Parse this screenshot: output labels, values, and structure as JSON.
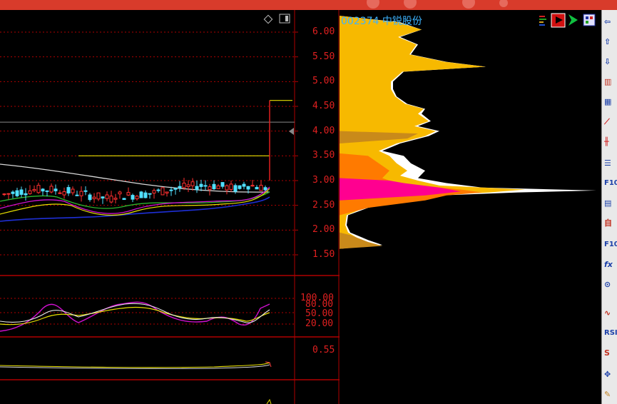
{
  "window": {
    "accent": "#d83b2b"
  },
  "stock": {
    "code": "002374",
    "name": "中锐股份",
    "label": "002374 中锐股份"
  },
  "price_axis": {
    "labels": [
      "6.00",
      "5.50",
      "5.00",
      "4.50",
      "4.00",
      "3.50",
      "3.00",
      "2.50",
      "2.00",
      "1.50"
    ]
  },
  "kdj_axis": {
    "labels": [
      "100.00",
      "80.00",
      "50.00",
      "20.00"
    ]
  },
  "sub_axis": {
    "labels": [
      "0.55"
    ]
  },
  "toolbar": {
    "items": [
      "back-arrow",
      "up-arrow",
      "down-arrow",
      "kline",
      "grid",
      "line",
      "candles",
      "list",
      "F10",
      "chip",
      "自",
      "F10",
      "fx",
      "search",
      "wave",
      "RS",
      "S",
      "move",
      "pen"
    ]
  },
  "tool_text": {
    "f10": "F10",
    "zi": "自",
    "f10b": "F10",
    "fx": "fx",
    "rsi": "RSI",
    "s": "S"
  },
  "chart_data": {
    "type": "candlestick",
    "ylim": [
      1.5,
      6.2
    ],
    "reference_lines": {
      "high_marker": 4.62,
      "white_line": 4.18,
      "yellow_line": 3.5
    },
    "volume_profile": {
      "price_levels": [
        1.65,
        1.8,
        1.95,
        2.1,
        2.25,
        2.4,
        2.55,
        2.7,
        2.8,
        2.9,
        3.0,
        3.1,
        3.2,
        3.3,
        3.45,
        3.6,
        3.8,
        4.0,
        4.2,
        4.4,
        4.6,
        4.8,
        5.0,
        5.2,
        5.35,
        5.5,
        5.7,
        5.9,
        6.05,
        6.25
      ],
      "colors": [
        "#f7b900",
        "#ff7a00",
        "#ff0090",
        "#ffffff",
        "#c98a1a"
      ]
    }
  }
}
